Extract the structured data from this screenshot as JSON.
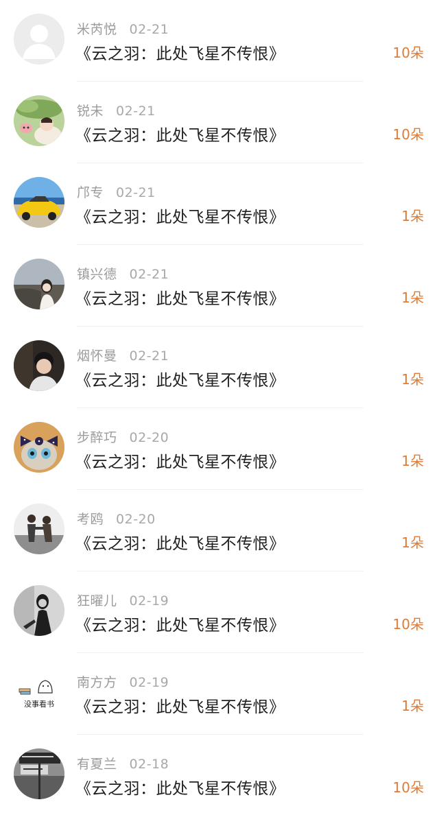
{
  "rows": [
    {
      "name": "米芮悦",
      "date": "02-21",
      "title": "《云之羽：此处飞星不传恨》",
      "gift": "10朵",
      "avatar": "default-avatar-icon"
    },
    {
      "name": "锐未",
      "date": "02-21",
      "title": "《云之羽：此处飞星不传恨》",
      "gift": "10朵",
      "avatar": "cartoon-lotus-avatar"
    },
    {
      "name": "邝专",
      "date": "02-21",
      "title": "《云之羽：此处飞星不传恨》",
      "gift": "1朵",
      "avatar": "yellow-car-avatar"
    },
    {
      "name": "镇兴德",
      "date": "02-21",
      "title": "《云之羽：此处飞星不传恨》",
      "gift": "1朵",
      "avatar": "girl-seaside-avatar"
    },
    {
      "name": "烟怀曼",
      "date": "02-21",
      "title": "《云之羽：此处飞星不传恨》",
      "gift": "1朵",
      "avatar": "boy-portrait-avatar"
    },
    {
      "name": "步醉巧",
      "date": "02-20",
      "title": "《云之羽：此处飞星不传恨》",
      "gift": "1朵",
      "avatar": "cat-bow-avatar"
    },
    {
      "name": "考鸥",
      "date": "02-20",
      "title": "《云之羽：此处飞星不传恨》",
      "gift": "1朵",
      "avatar": "couple-dance-avatar"
    },
    {
      "name": "狂曜儿",
      "date": "02-19",
      "title": "《云之羽：此处飞星不传恨》",
      "gift": "10朵",
      "avatar": "bw-girl-avatar"
    },
    {
      "name": "南方方",
      "date": "02-19",
      "title": "《云之羽：此处飞星不传恨》",
      "gift": "1朵",
      "avatar": "reading-cartoon-avatar",
      "avatar_text": "没事看书"
    },
    {
      "name": "有夏兰",
      "date": "02-18",
      "title": "《云之羽：此处飞星不传恨》",
      "gift": "10朵",
      "avatar": "street-sign-avatar"
    }
  ]
}
